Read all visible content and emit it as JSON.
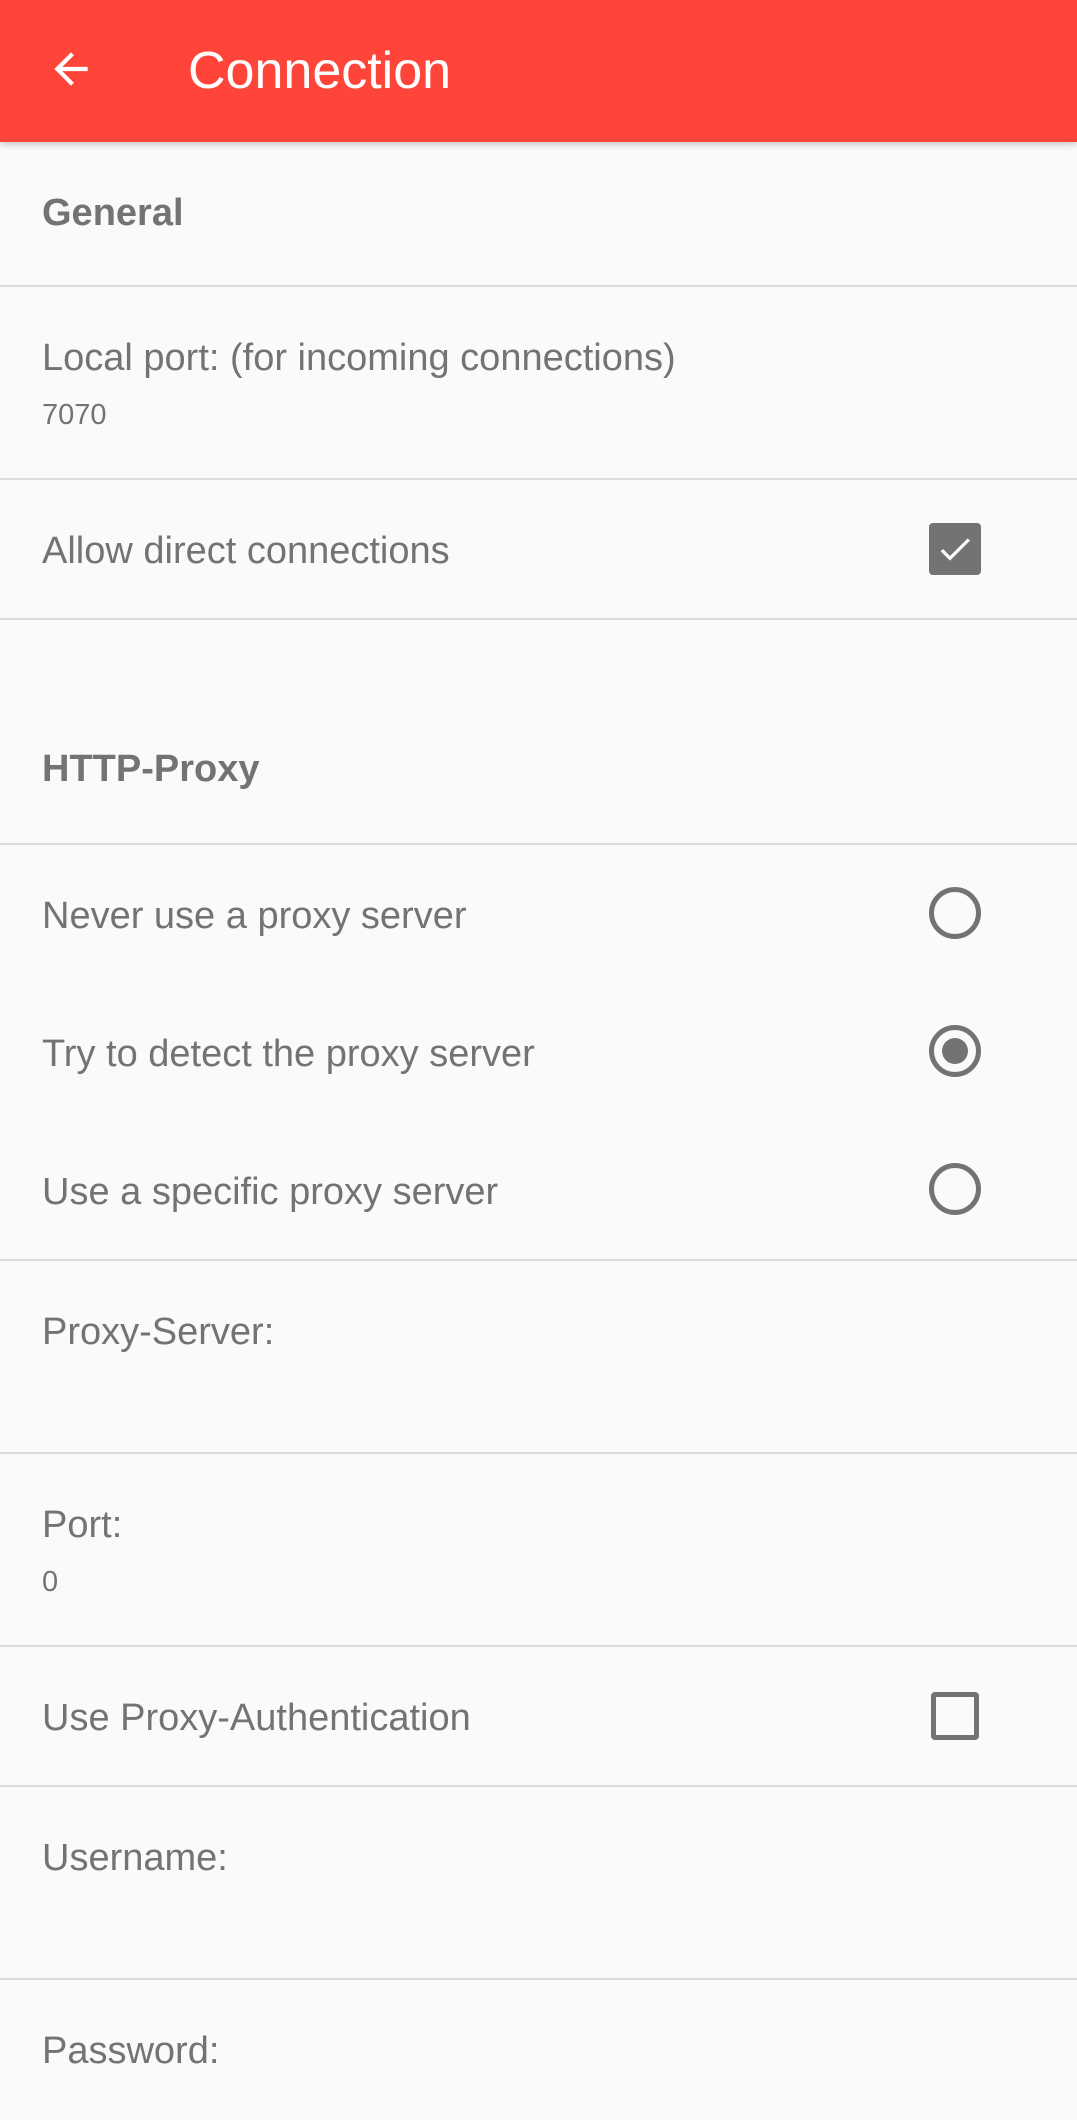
{
  "appbar": {
    "title": "Connection",
    "back_icon": "arrow-back-icon",
    "color": "#ff4439"
  },
  "general": {
    "header": "General",
    "local_port": {
      "title": "Local port: (for incoming connections)",
      "value": "7070"
    },
    "allow_direct": {
      "title": "Allow direct connections",
      "checked": true
    }
  },
  "http_proxy": {
    "header": "HTTP-Proxy",
    "options": [
      {
        "label": "Never use a proxy server",
        "selected": false
      },
      {
        "label": "Try to detect the proxy server",
        "selected": true
      },
      {
        "label": "Use a specific proxy server",
        "selected": false
      }
    ],
    "proxy_server": {
      "title": "Proxy-Server:",
      "value": ""
    },
    "port": {
      "title": "Port:",
      "value": "0"
    },
    "use_auth": {
      "title": "Use Proxy-Authentication",
      "checked": false
    },
    "username": {
      "title": "Username:",
      "value": ""
    },
    "password": {
      "title": "Password:"
    }
  }
}
